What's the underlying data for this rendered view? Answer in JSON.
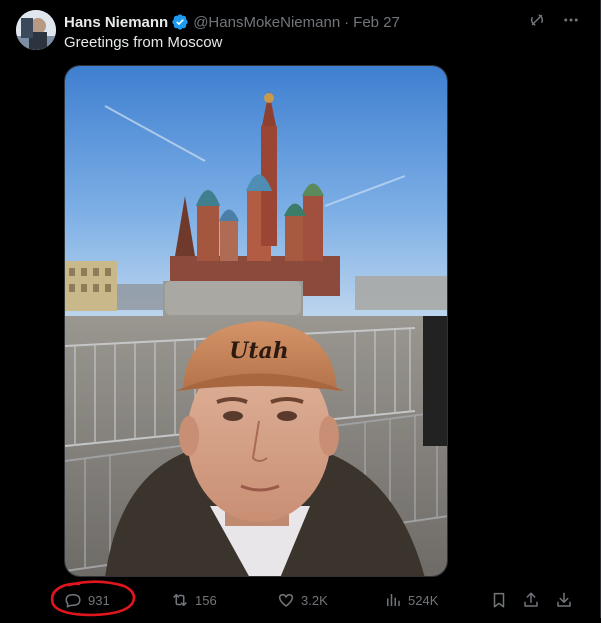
{
  "colors": {
    "background": "#000000",
    "text_primary": "#e7e9ea",
    "text_secondary": "#71767b",
    "verified_blue": "#1d9bf0",
    "annotation_red": "#e0161e"
  },
  "author": {
    "display_name": "Hans Niemann",
    "handle": "@HansMokeNiemann",
    "separator": "·",
    "date": "Feb 27",
    "verified": true
  },
  "tweet": {
    "text": "Greetings from Moscow",
    "media_alt": "Selfie in front of St. Basil's Cathedral, Red Square, Moscow"
  },
  "header_icons": [
    "grok-icon",
    "more-icon"
  ],
  "actions": {
    "replies": {
      "icon": "reply-icon",
      "count": "931"
    },
    "reposts": {
      "icon": "repost-icon",
      "count": "156"
    },
    "likes": {
      "icon": "like-icon",
      "count": "3.2K"
    },
    "views": {
      "icon": "views-icon",
      "count": "524K"
    },
    "bookmark": {
      "icon": "bookmark-icon"
    },
    "share": {
      "icon": "share-icon"
    },
    "download": {
      "icon": "download-icon"
    }
  },
  "annotation": {
    "shape": "hand-drawn circle",
    "target": "replies-count"
  }
}
